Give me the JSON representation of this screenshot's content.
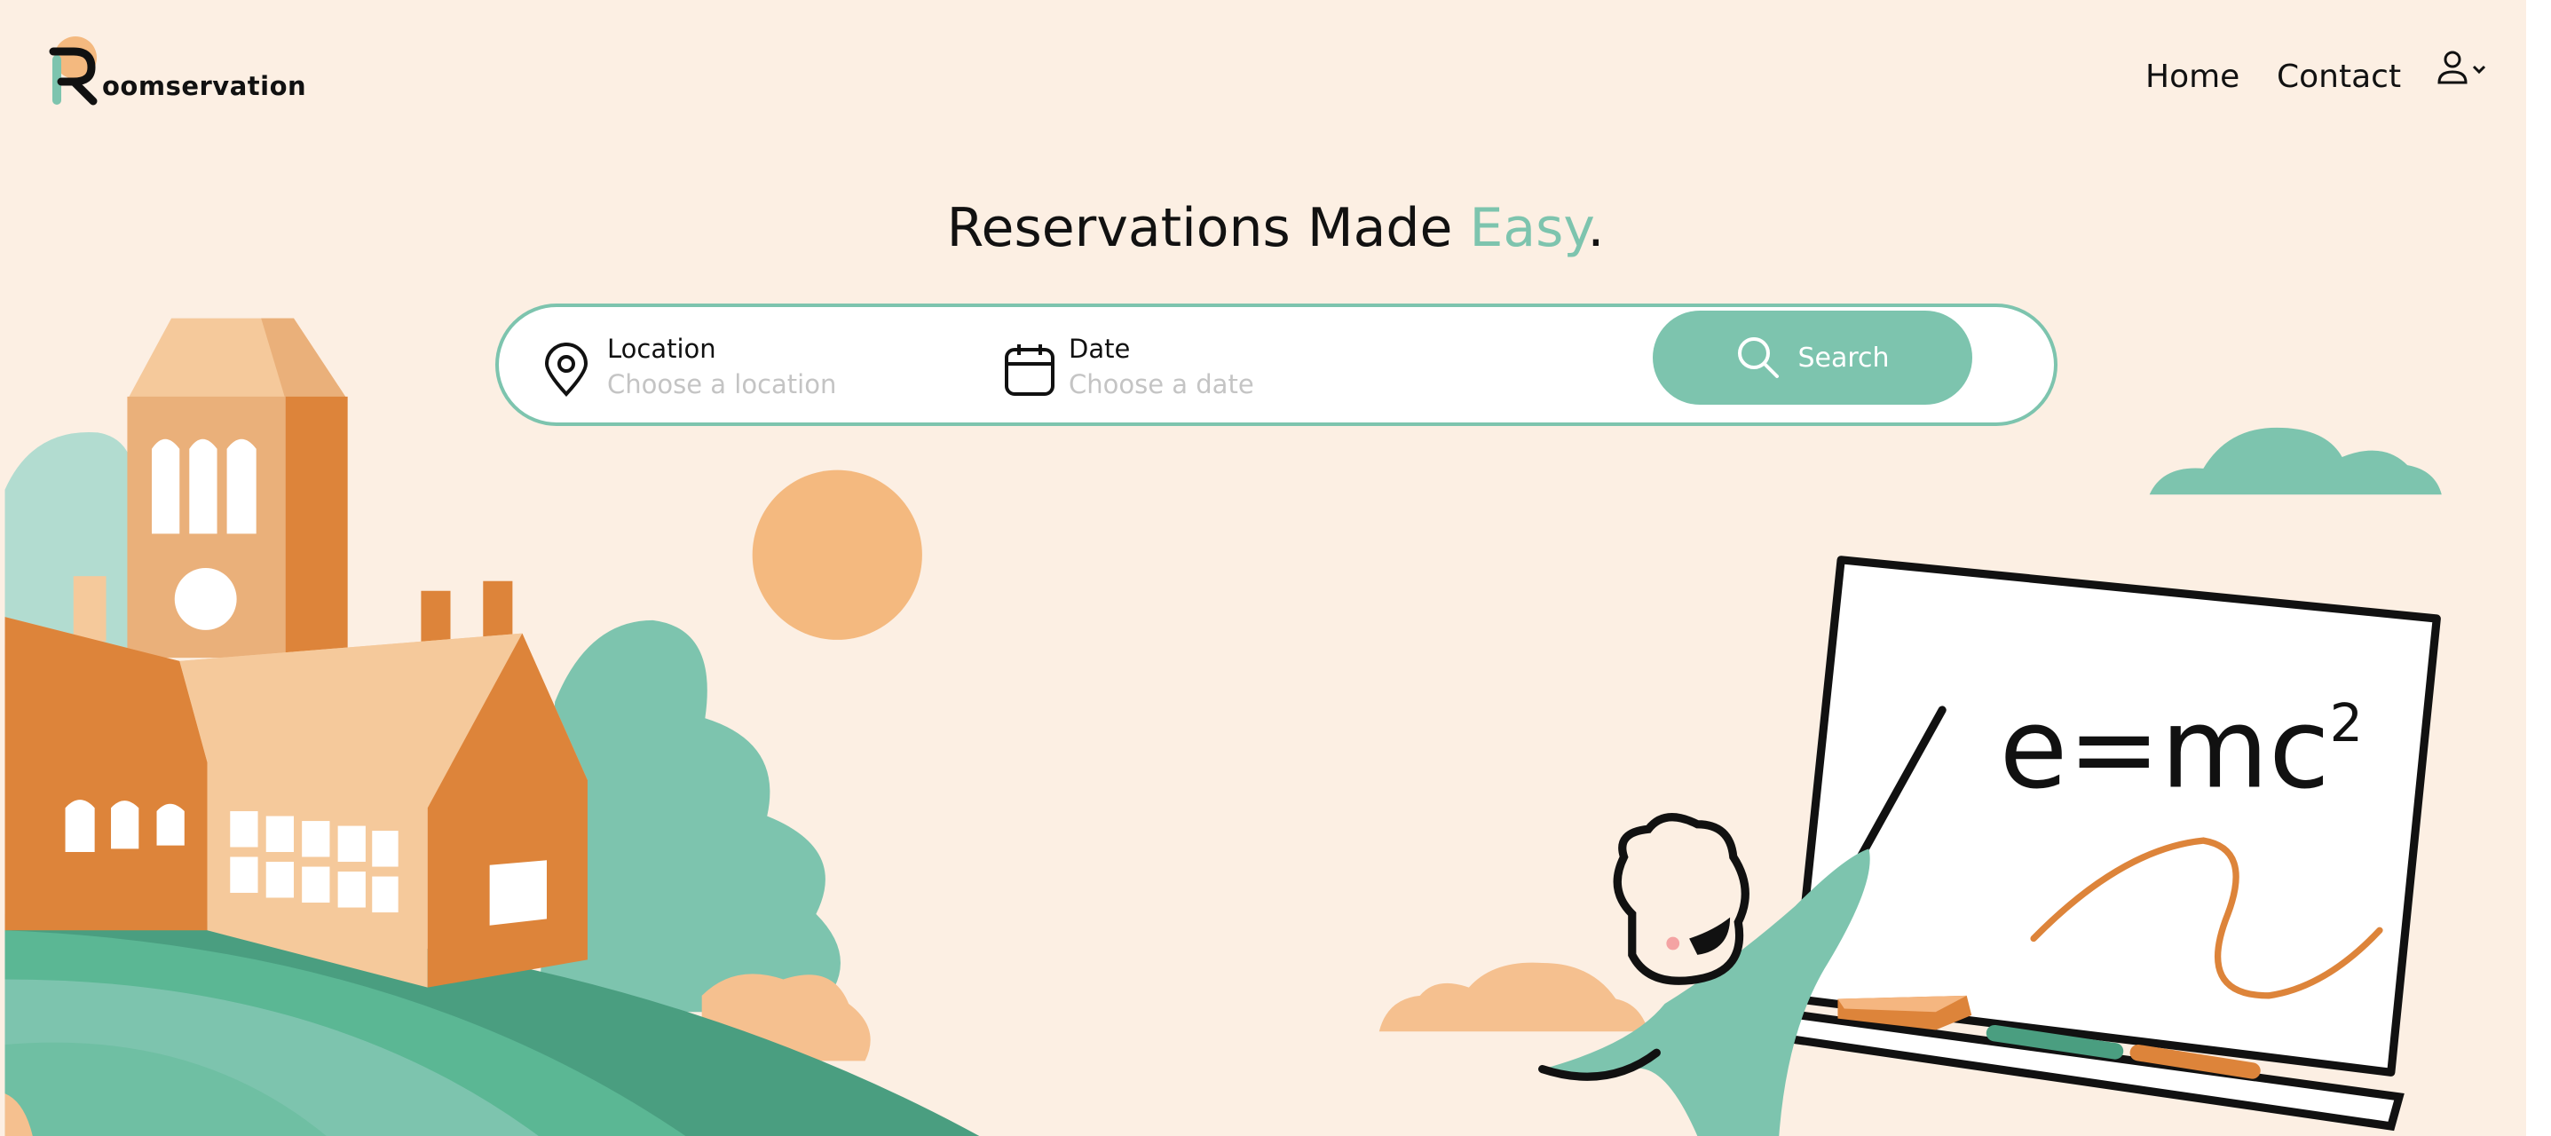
{
  "brand": {
    "name": "oomservation",
    "logo_letter": "R"
  },
  "nav": {
    "items": [
      {
        "label": "Home"
      },
      {
        "label": "Contact"
      }
    ],
    "user_icon": "user-icon",
    "dropdown_icon": "chevron-down-icon"
  },
  "hero": {
    "title_start": "Reservations Made ",
    "title_accent": "Easy",
    "title_end": "."
  },
  "search": {
    "location": {
      "label": "Location",
      "placeholder": "Choose a location",
      "icon": "map-pin-icon"
    },
    "date": {
      "label": "Date",
      "placeholder": "Choose a date",
      "icon": "calendar-icon"
    },
    "button_label": "Search",
    "button_icon": "search-icon"
  },
  "illustration": {
    "board_text": "e=mc",
    "board_sup": "2"
  },
  "colors": {
    "background": "#fcefe3",
    "accent": "#7dc4ae",
    "orange": "#dd843a",
    "peach": "#f4b97f"
  }
}
